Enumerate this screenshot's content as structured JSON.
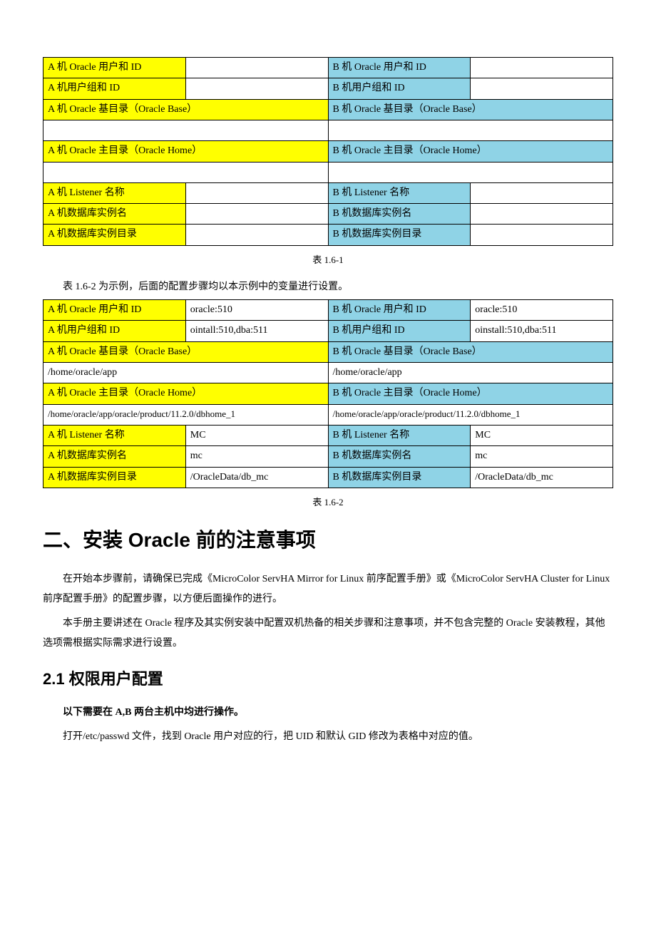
{
  "table1": {
    "rows": [
      [
        "A 机 Oracle 用户和 ID",
        "",
        "B 机 Oracle 用户和 ID",
        ""
      ],
      [
        "A 机用户组和 ID",
        "",
        "B 机用户组和 ID",
        ""
      ],
      [
        "A 机 Oracle 基目录（Oracle Base）",
        "B 机 Oracle 基目录（Oracle Base）"
      ],
      [
        "",
        ""
      ],
      [
        "A 机 Oracle 主目录（Oracle Home）",
        "B 机 Oracle 主目录（Oracle Home）"
      ],
      [
        "",
        ""
      ],
      [
        "A 机 Listener 名称",
        "",
        "B 机 Listener 名称",
        ""
      ],
      [
        "A 机数据库实例名",
        "",
        "B 机数据库实例名",
        ""
      ],
      [
        "A 机数据库实例目录",
        "",
        "B 机数据库实例目录",
        ""
      ]
    ],
    "caption": "表 1.6-1"
  },
  "intro_1": "表 1.6-2 为示例，后面的配置步骤均以本示例中的变量进行设置。",
  "table2": {
    "rows": [
      [
        "A 机 Oracle 用户和 ID",
        "oracle:510",
        "B 机 Oracle 用户和 ID",
        "oracle:510"
      ],
      [
        "A 机用户组和 ID",
        "ointall:510,dba:511",
        "B 机用户组和 ID",
        "oinstall:510,dba:511"
      ],
      [
        "A 机 Oracle 基目录（Oracle Base）",
        "B 机 Oracle 基目录（Oracle Base）"
      ],
      [
        "/home/oracle/app",
        "/home/oracle/app"
      ],
      [
        "A 机 Oracle 主目录（Oracle Home）",
        "B 机 Oracle 主目录（Oracle Home）"
      ],
      [
        "/home/oracle/app/oracle/product/11.2.0/dbhome_1",
        "/home/oracle/app/oracle/product/11.2.0/dbhome_1"
      ],
      [
        "A 机 Listener 名称",
        "MC",
        "B 机 Listener 名称",
        "MC"
      ],
      [
        "A 机数据库实例名",
        "mc",
        "B 机数据库实例名",
        "mc"
      ],
      [
        "A 机数据库实例目录",
        "/OracleData/db_mc",
        "B 机数据库实例目录",
        "/OracleData/db_mc"
      ]
    ],
    "caption": "表 1.6-2"
  },
  "h2_text": "二、安装 Oracle 前的注意事项",
  "para1": "在开始本步骤前，请确保已完成《MicroColor ServHA Mirror for Linux 前序配置手册》或《MicroColor ServHA Cluster for Linux 前序配置手册》的配置步骤，以方便后面操作的进行。",
  "para2": "本手册主要讲述在 Oracle 程序及其实例安装中配置双机热备的相关步骤和注意事项，并不包含完整的 Oracle 安装教程，其他选项需根据实际需求进行设置。",
  "h3_text": "2.1 权限用户配置",
  "para3": "以下需要在 A,B 两台主机中均进行操作。",
  "para4": "打开/etc/passwd 文件，找到 Oracle 用户对应的行，把 UID 和默认 GID 修改为表格中对应的值。"
}
